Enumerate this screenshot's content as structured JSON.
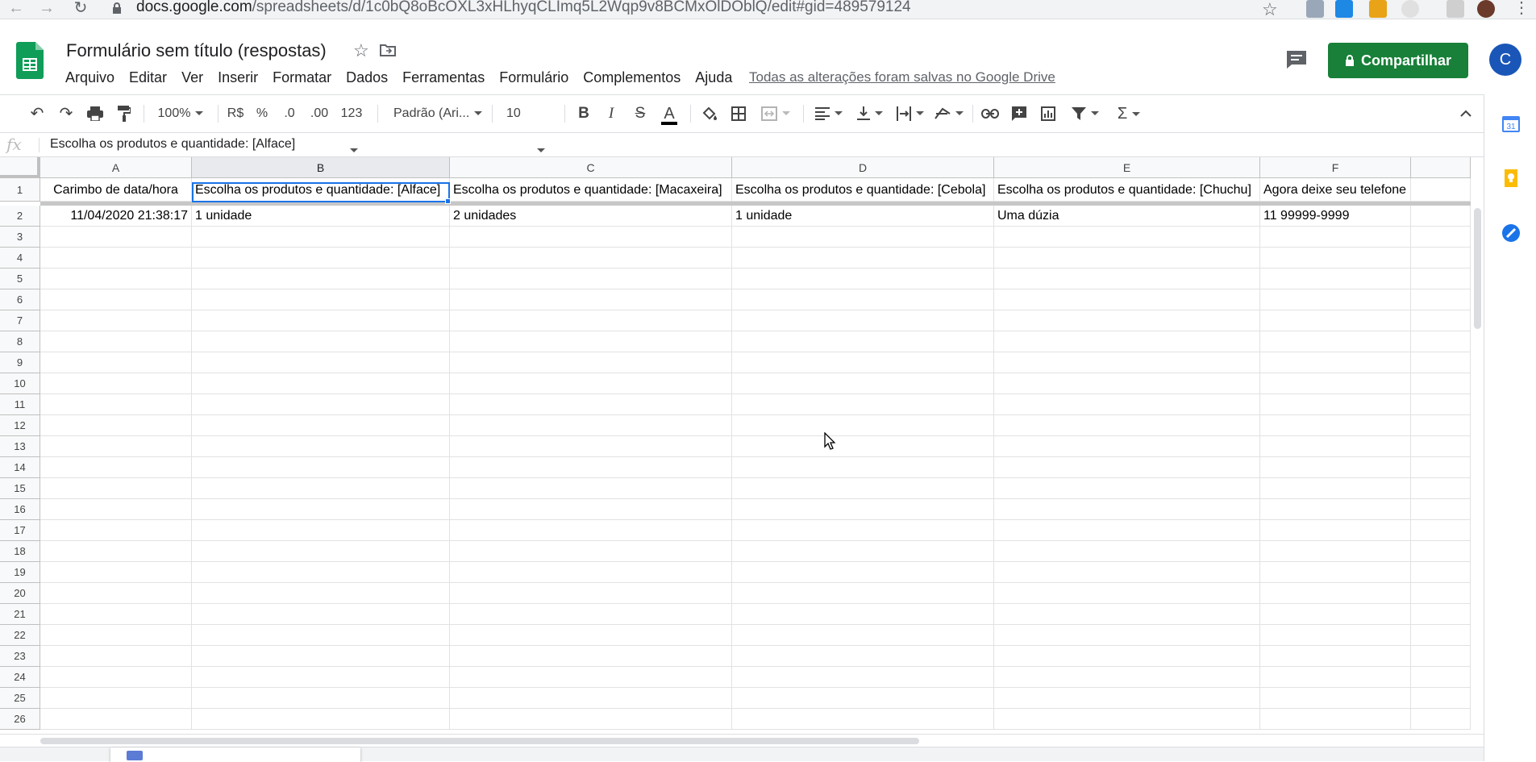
{
  "browser": {
    "url_host": "docs.google.com",
    "url_path": "/spreadsheets/d/1c0bQ8oBcOXL3xHLhyqCLImq5L2Wqp9v8BCMxOlDOblQ/edit#gid=489579124"
  },
  "header": {
    "title": "Formulário sem título (respostas)",
    "save_status": "Todas as alterações foram salvas no Google Drive",
    "share_label": "Compartilhar",
    "avatar_letter": "C"
  },
  "menu": [
    "Arquivo",
    "Editar",
    "Ver",
    "Inserir",
    "Formatar",
    "Dados",
    "Ferramentas",
    "Formulário",
    "Complementos",
    "Ajuda"
  ],
  "toolbar": {
    "zoom": "100%",
    "currency": "R$",
    "percent": "%",
    "decrease_decimal": ".0",
    "increase_decimal": ".00",
    "more_formats": "123",
    "font": "Padrão (Ari...",
    "font_size": "10",
    "bold": "B",
    "italic": "I",
    "strike": "S",
    "text_color": "A",
    "functions": "Σ"
  },
  "formula_bar": {
    "fx": "fx",
    "content": "Escolha os produtos e quantidade: [Alface]"
  },
  "sheet": {
    "columns": [
      "A",
      "B",
      "C",
      "D",
      "E",
      "F"
    ],
    "selected_column": "B",
    "header_row": [
      "Carimbo de data/hora",
      "Escolha os produtos e quantidade: [Alface]",
      "Escolha os produtos e quantidade: [Macaxeira]",
      "Escolha os produtos e quantidade: [Cebola]",
      "Escolha os produtos e quantidade: [Chuchu]",
      "Agora deixe seu telefone e entraremos"
    ],
    "data_row": [
      "11/04/2020 21:38:17",
      "1 unidade",
      "2 unidades",
      "1 unidade",
      "Uma dúzia",
      "11 99999-9999"
    ],
    "row_numbers": [
      "1",
      "2",
      "3",
      "4",
      "5",
      "6",
      "7",
      "8",
      "9",
      "10",
      "11",
      "12",
      "13",
      "14",
      "15",
      "16",
      "17",
      "18",
      "19",
      "20",
      "21",
      "22",
      "23",
      "24",
      "25",
      "26"
    ]
  },
  "side_panel": {
    "calendar_day": "31"
  },
  "colors": {
    "share_green": "#188038",
    "selection_blue": "#1a73e8",
    "avatar_blue": "#1a56b7"
  }
}
